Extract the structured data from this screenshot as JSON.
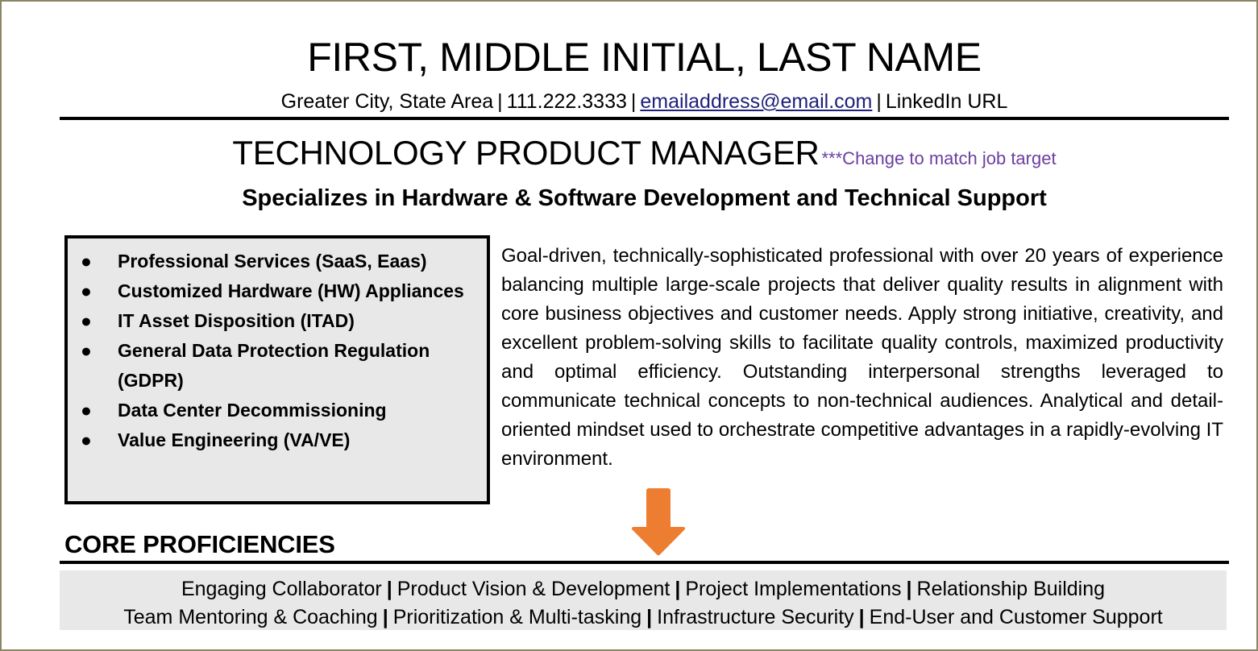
{
  "document": {
    "name": "FIRST, MIDDLE INITIAL, LAST NAME",
    "contact": {
      "location": "Greater City, State Area",
      "phone": "111.222.3333",
      "email": "emailaddress@email.com",
      "linkedin": "LinkedIn URL",
      "separator": "|"
    },
    "target_title": "TECHNOLOGY PRODUCT MANAGER",
    "target_note": "***Change to match job target",
    "subtitle": "Specializes in Hardware & Software Development and Technical Support",
    "summary": "Goal-driven, technically-sophisticated professional with over 20 years of experience balancing multiple large-scale projects that deliver quality results in alignment with core business objectives and customer needs.  Apply strong initiative, creativity, and excellent problem-solving skills to facilitate quality controls, maximized productivity and optimal efficiency. Outstanding interpersonal strengths leveraged to communicate technical concepts to non-technical audiences.  Analytical and detail-oriented mindset used to orchestrate competitive advantages in a rapidly-evolving IT environment."
  },
  "skills_box": {
    "bullet_glyph": "●",
    "items": [
      "Professional Services (SaaS, Eaas)",
      "Customized Hardware (HW) Appliances",
      "IT Asset Disposition (ITAD)",
      "General Data Protection Regulation (GDPR)",
      "Data Center Decommissioning",
      "Value Engineering (VA/VE)"
    ]
  },
  "core_proficiencies": {
    "heading": "CORE PROFICIENCIES",
    "separator": "|",
    "row1": [
      "Engaging Collaborator",
      "Product Vision & Development",
      "Project Implementations",
      "Relationship Building"
    ],
    "row2": [
      "Team Mentoring & Coaching",
      "Prioritization & Multi-tasking",
      "Infrastructure Security",
      "End-User and Customer Support"
    ]
  },
  "annotations": {
    "arrow": "down-arrow",
    "arrow_color": "#ed7d31",
    "note_color": "#6b3fa0",
    "link_color": "#1f1f7a",
    "box_fill": "#e8e8e8",
    "rule_color": "#000000"
  }
}
